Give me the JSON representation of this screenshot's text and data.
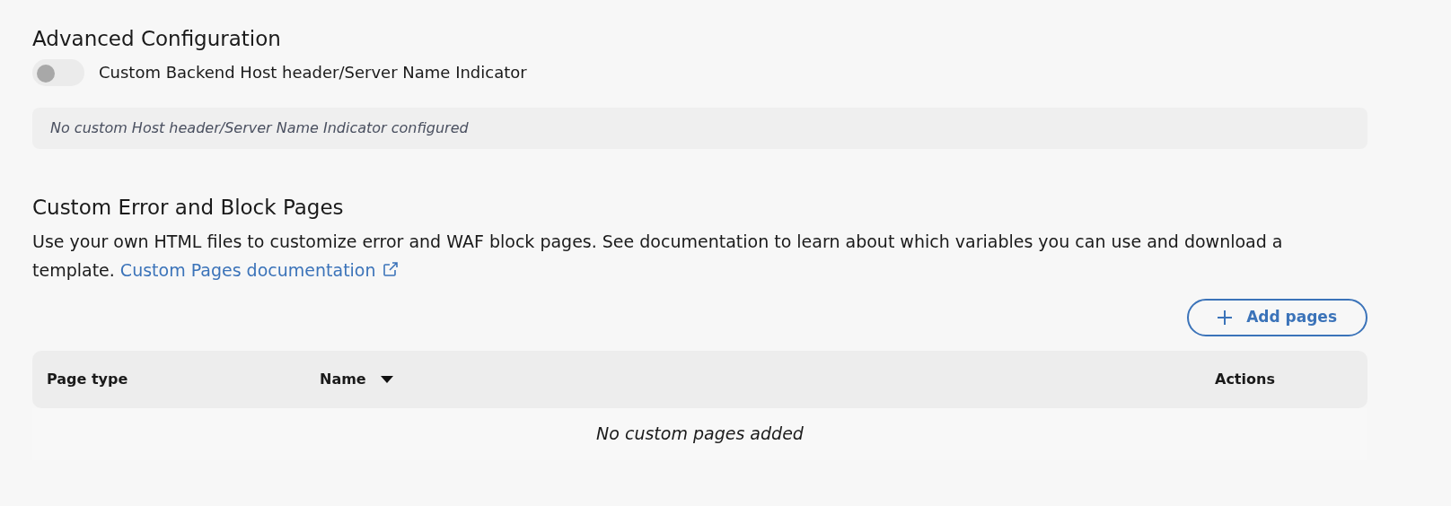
{
  "advanced": {
    "title": "Advanced Configuration",
    "toggle": {
      "label": "Custom Backend Host header/Server Name Indicator",
      "on": false
    },
    "info": "No custom Host header/Server Name Indicator configured"
  },
  "custom_pages": {
    "title": "Custom Error and Block Pages",
    "description": "Use your own HTML files to customize error and WAF block pages. See documentation to learn about which variables you can use and download a template.",
    "link": "Custom Pages documentation",
    "add_button": "Add pages",
    "table": {
      "columns": [
        {
          "label": "Page type",
          "sorted": false
        },
        {
          "label": "Name",
          "sorted": true
        },
        {
          "label": "Actions",
          "sorted": false
        }
      ],
      "empty": "No custom pages added"
    }
  }
}
